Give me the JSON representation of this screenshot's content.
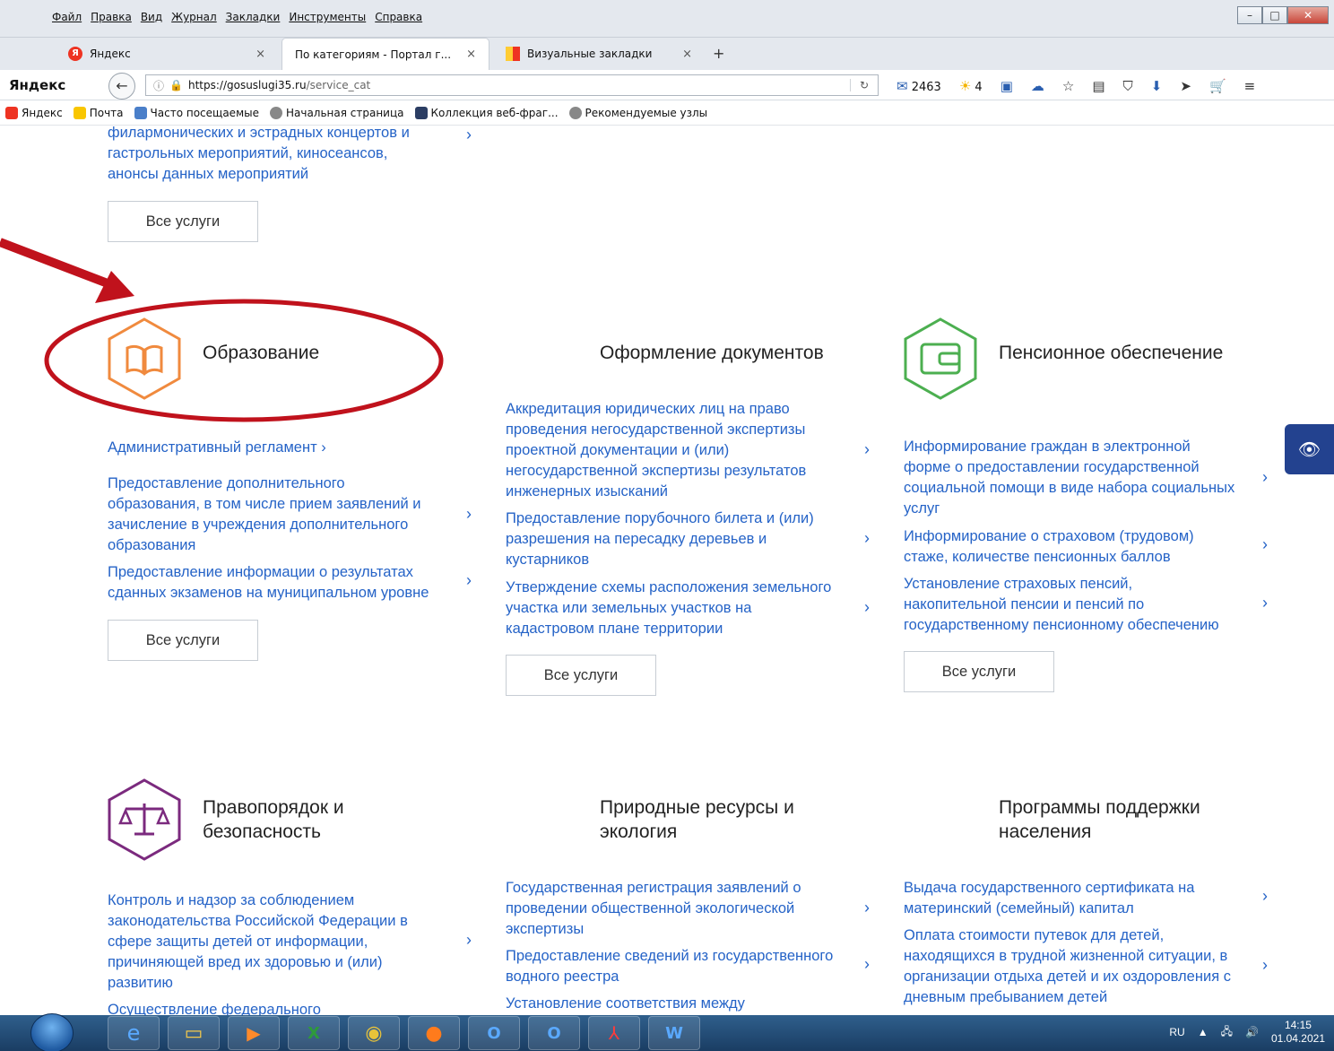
{
  "menubar": {
    "items": [
      "Файл",
      "Правка",
      "Вид",
      "Журнал",
      "Закладки",
      "Инструменты",
      "Справка"
    ],
    "controls": [
      "–",
      "□",
      "✕"
    ]
  },
  "tabs": [
    {
      "label": "Яндекс",
      "active": false
    },
    {
      "label": "По категориям - Портал г...",
      "active": true
    },
    {
      "label": "Визуальные закладки",
      "active": false
    }
  ],
  "navbar": {
    "logo": "Яндекс",
    "url_domain": "https://gosuslugi35.ru",
    "url_path": "/service_cat",
    "mail_count": "2463",
    "weather": "4"
  },
  "bookmarks": [
    "Яндекс",
    "Почта",
    "Часто посещаемые",
    "Начальная страница",
    "Коллекция веб-фраг...",
    "Рекомендуемые узлы"
  ],
  "top_partial": {
    "lines": [
      "филармонических и эстрадных концертов и",
      "гастрольных мероприятий, киносеансов,",
      "анонсы данных мероприятий"
    ],
    "all_label": "Все услуги"
  },
  "education": {
    "title": "Образование",
    "reglament": "Административный регламент",
    "services": [
      [
        "Предоставление дополнительного",
        "образования, в том числе прием заявлений и",
        "зачисление в учреждения дополнительного",
        "образования"
      ],
      [
        "Предоставление информации о результатах",
        "сданных экзаменов на муниципальном уровне"
      ]
    ],
    "all_label": "Все услуги"
  },
  "documents": {
    "title": "Оформление документов",
    "services": [
      [
        "Аккредитация юридических лиц на право",
        "проведения негосударственной экспертизы",
        "проектной документации и (или)",
        "негосударственной экспертизы результатов",
        "инженерных изысканий"
      ],
      [
        "Предоставление порубочного билета и (или)",
        "разрешения на пересадку деревьев и",
        "кустарников"
      ],
      [
        "Утверждение схемы расположения земельного",
        "участка или земельных участков на",
        "кадастровом плане территории"
      ]
    ],
    "all_label": "Все услуги"
  },
  "pension": {
    "title": "Пенсионное обеспечение",
    "services": [
      [
        "Информирование граждан в электронной",
        "форме о предоставлении государственной",
        "социальной помощи в виде набора социальных",
        "услуг"
      ],
      [
        "Информирование о страховом (трудовом)",
        "стаже, количестве пенсионных баллов"
      ],
      [
        "Установление страховых пенсий,",
        "накопительной пенсии и пенсий по",
        "государственному пенсионному обеспечению"
      ]
    ],
    "all_label": "Все услуги"
  },
  "law": {
    "title": [
      "Правопорядок и",
      "безопасность"
    ],
    "services": [
      [
        "Контроль и надзор за соблюдением",
        "законодательства Российской Федерации в",
        "сфере защиты детей от информации,",
        "причиняющей вред их здоровью и (или)",
        "развитию"
      ],
      [
        "Осуществление федерального"
      ]
    ]
  },
  "nature": {
    "title": [
      "Природные ресурсы и",
      "экология"
    ],
    "services": [
      [
        "Государственная регистрация заявлений о",
        "проведении общественной экологической",
        "экспертизы"
      ],
      [
        "Предоставление сведений из государственного",
        "водного реестра"
      ],
      [
        "Установление соответствия между"
      ]
    ]
  },
  "support": {
    "title": [
      "Программы поддержки",
      "населения"
    ],
    "services": [
      [
        "Выдача государственного сертификата на",
        "материнский (семейный) капитал"
      ],
      [
        "Оплата стоимости путевок для детей,",
        "находящихся в трудной жизненной ситуации, в",
        "организации отдыха детей и их оздоровления с",
        "дневным пребыванием детей"
      ]
    ]
  },
  "colors": {
    "link": "#2563c7",
    "education_icon": "#f08a3e",
    "pension_icon": "#4caf50",
    "law_icon": "#7b2a7e",
    "annotation": "#c0121c"
  },
  "taskbar": {
    "lang": "RU",
    "time": "14:15",
    "date": "01.04.2021"
  }
}
